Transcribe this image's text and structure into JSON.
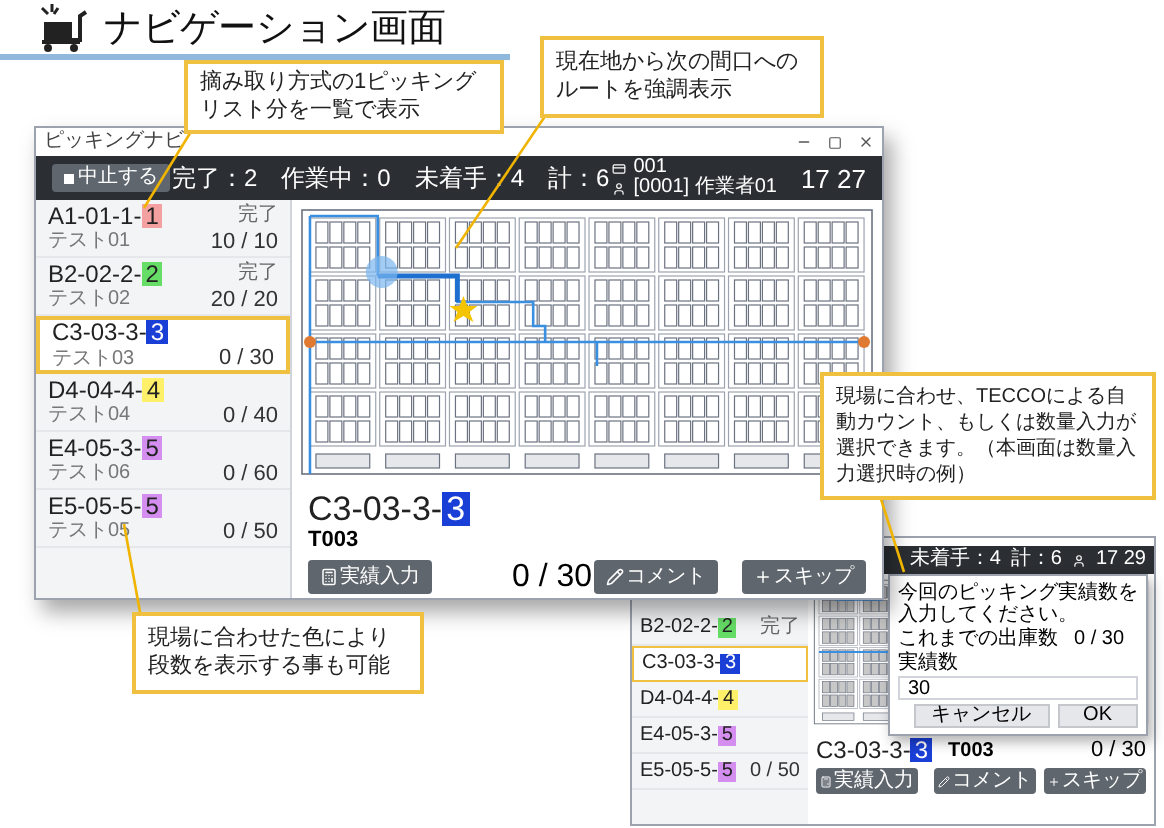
{
  "title": "ナビゲーション画面",
  "main_window": {
    "title": "ピッキングナビ",
    "stop_button": "中止する",
    "stats": [
      "完了：2",
      "作業中：0",
      "未着手：4",
      "計：6"
    ],
    "user_id": "001",
    "user_name": "[0001] 作業者01",
    "time": "17 27",
    "list": [
      {
        "location": "A1-01-1-",
        "tier": "1",
        "color": "#f4a0a0",
        "name": "テスト01",
        "status": "完了",
        "count": "10 / 10",
        "selected": false
      },
      {
        "location": "B2-02-2-",
        "tier": "2",
        "color": "#66dd66",
        "name": "テスト02",
        "status": "完了",
        "count": "20 / 20",
        "selected": false
      },
      {
        "location": "C3-03-3-",
        "tier": "3",
        "color": "#1a3fd6",
        "name": "テスト03",
        "count": "0 / 30",
        "selected": true
      },
      {
        "location": "D4-04-4-",
        "tier": "4",
        "color": "#fff06a",
        "name": "テスト04",
        "count": "0 / 40",
        "selected": false
      },
      {
        "location": "E4-05-3-",
        "tier": "5",
        "color": "#d48ef0",
        "name": "テスト06",
        "count": "0 / 60",
        "selected": false
      },
      {
        "location": "E5-05-5-",
        "tier": "5",
        "color": "#d48ef0",
        "name": "テスト05",
        "count": "0 / 50",
        "selected": false
      }
    ],
    "current": {
      "location": "C3-03-3-",
      "tier": "3",
      "color": "#1a3fd6",
      "code": "T003",
      "count": "0 / 30"
    },
    "buttons": {
      "input": "実績入力",
      "comment": "コメント",
      "skip": "スキップ"
    }
  },
  "second_window": {
    "stats": [
      "未着手：4",
      "計：6"
    ],
    "time": "17 29",
    "list": [
      {
        "location": "B2-02-2-",
        "tier": "2",
        "color": "#66dd66",
        "status": "完了",
        "selected": false
      },
      {
        "location": "C3-03-3-",
        "tier": "3",
        "color": "#1a3fd6",
        "selected": true
      },
      {
        "location": "D4-04-4-",
        "tier": "4",
        "color": "#fff06a",
        "selected": false
      },
      {
        "location": "E4-05-3-",
        "tier": "5",
        "color": "#d48ef0",
        "selected": false
      },
      {
        "location": "E5-05-5-",
        "tier": "5",
        "color": "#d48ef0",
        "count": "0 / 50",
        "selected": false
      }
    ],
    "dialog": {
      "message": "今回のピッキング実績数を入力してください。",
      "shipped_label": "これまでの出庫数",
      "shipped_value": "0 / 30",
      "field_label": "実績数",
      "field_value": "30",
      "cancel": "キャンセル",
      "ok": "OK"
    },
    "current": {
      "location": "C3-03-3-",
      "tier": "3",
      "color": "#1a3fd6",
      "code": "T003",
      "count": "0 / 30"
    },
    "buttons": {
      "input": "実績入力",
      "comment": "コメント",
      "skip": "スキップ"
    }
  },
  "callouts": [
    {
      "text": "摘み取り方式の1ピッキングリスト分を一覧で表示"
    },
    {
      "text": "現在地から次の間口へのルートを強調表示"
    },
    {
      "text": "現場に合わせ、TECCOによる自動カウント、もしくは数量入力が選択できます。（本画面は数量入力選択時の例）"
    },
    {
      "text": "現場に合わせた色により段数を表示する事も可能"
    }
  ]
}
